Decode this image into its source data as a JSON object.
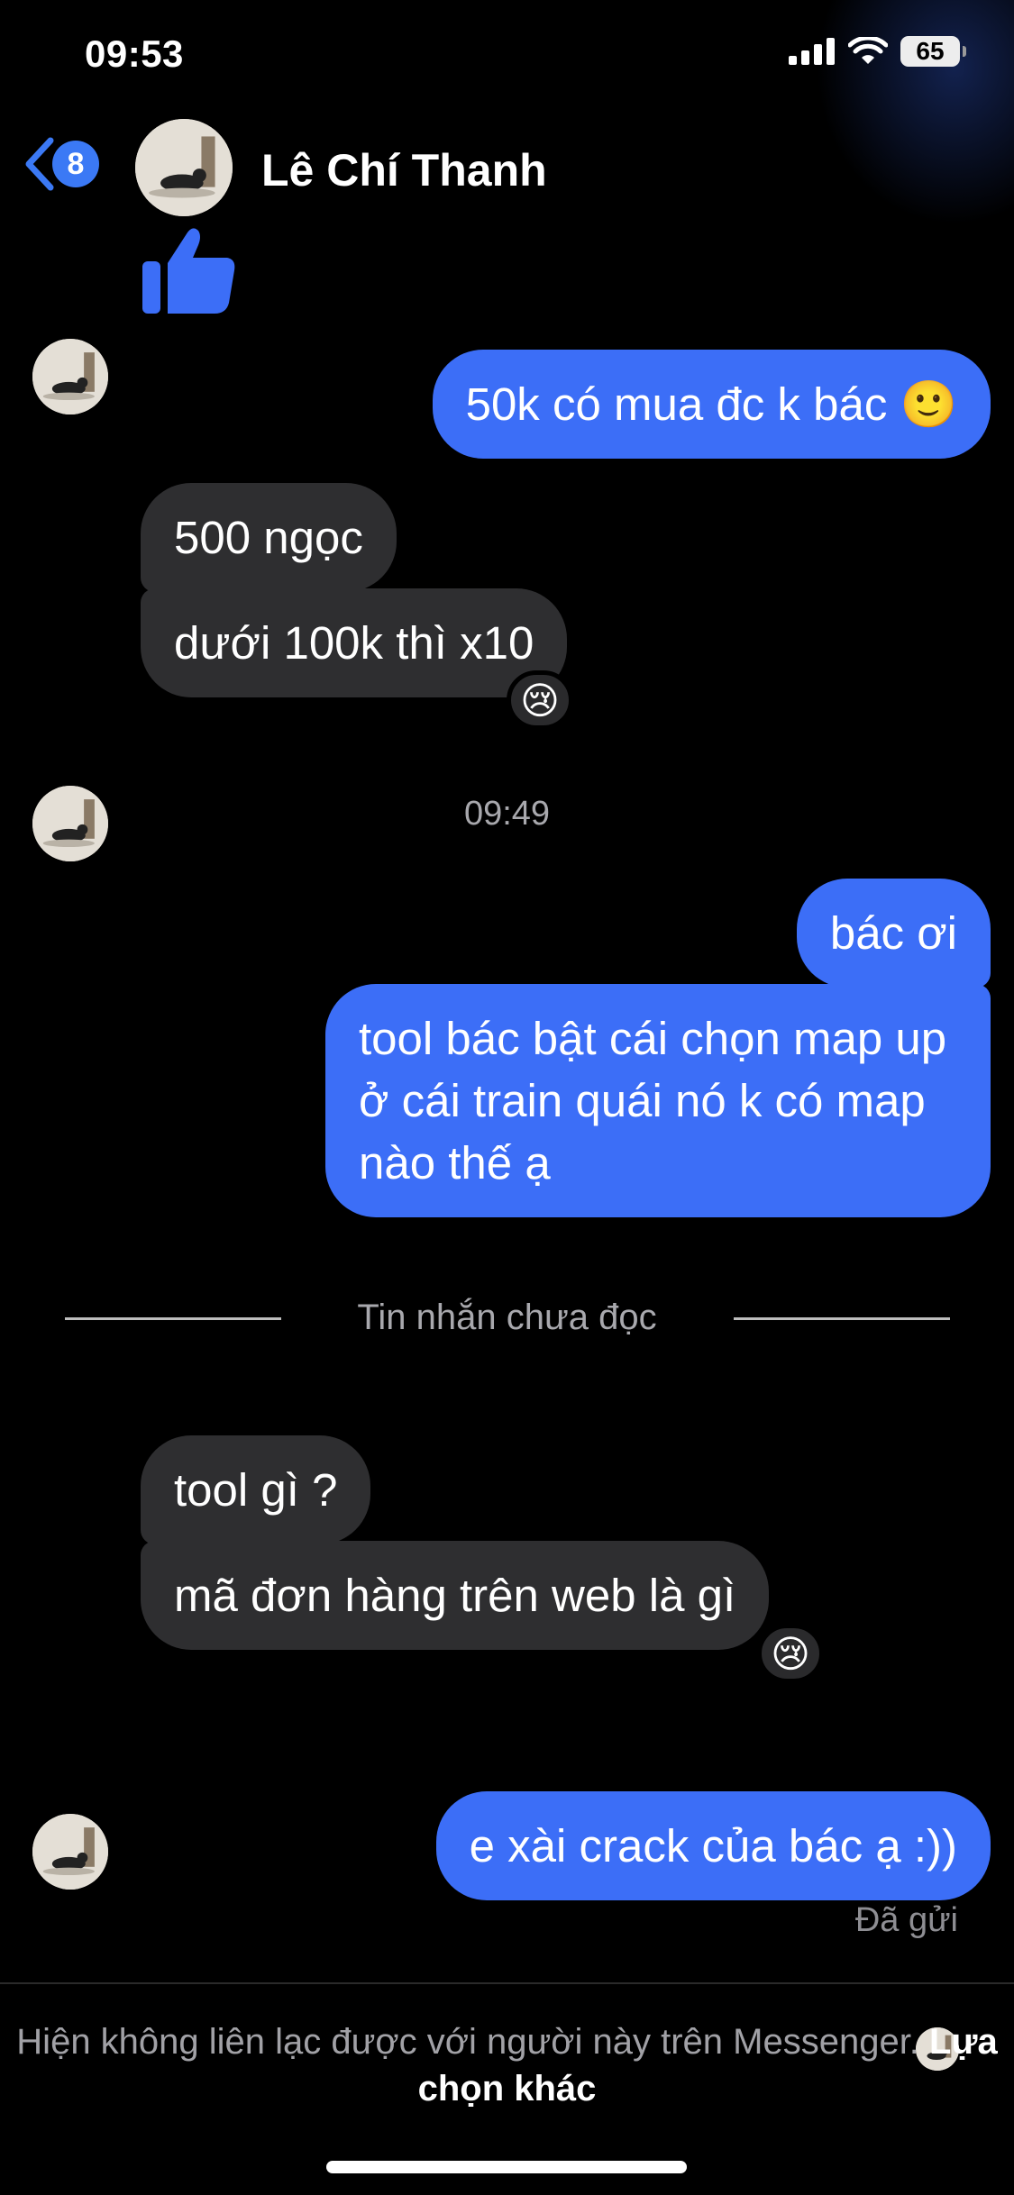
{
  "status_bar": {
    "time": "09:53",
    "battery": "65"
  },
  "header": {
    "back_count": "8",
    "contact_name": "Lê Chí Thanh"
  },
  "messages": {
    "out_1": "50k có mua đc k bác 🙂",
    "in_1": "500 ngọc",
    "in_2": "dưới 100k thì x10",
    "reaction_1": "😢",
    "timestamp": "09:49",
    "out_2": "bác ơi",
    "out_3": "tool bác bật cái chọn map up ở cái train quái nó k có map nào thế ạ",
    "unread_label": "Tin nhắn chưa đọc",
    "in_3": "tool gì ?",
    "in_4": "mã đơn hàng trên web là gì",
    "reaction_2": "😢",
    "out_4": "e xài crack của bác ạ :))",
    "sent_status": "Đã gửi"
  },
  "footer": {
    "notice": "Hiện không liên lạc được với người này trên Messenger.",
    "link": "Lựa chọn khác"
  },
  "colors": {
    "outgoing_bubble": "#3c6ef7",
    "incoming_bubble": "#2e2e30",
    "accent": "#3b79f5"
  },
  "icons": [
    "signal-icon",
    "wifi-icon",
    "battery-icon",
    "back-chevron-icon",
    "thumbs-up-icon",
    "avatar"
  ]
}
